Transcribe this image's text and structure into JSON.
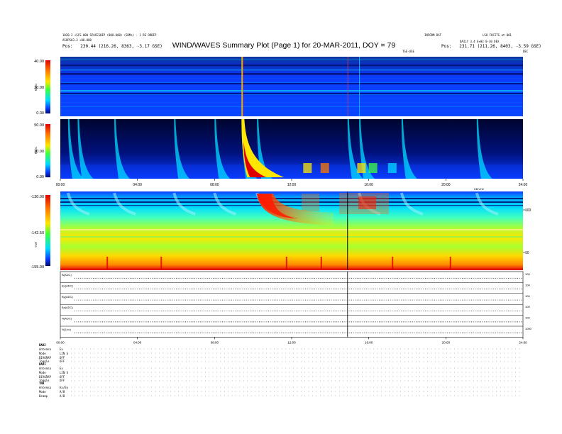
{
  "header": {
    "title": "WIND/WAVES Summary Plot (Page 1) for 20-MAR-2011, DOY = 79",
    "left_line1": "1020.3 ×SCS.000 SPACESHIP (008.000) (SDMs) - 1 RE ORBIP",
    "left_line2": "ASUPS03.3 ×00.000",
    "left_pos": "Pos:   230.44 (216.26, 8363, -3.17 GSE)",
    "right_top1": "INFORM DAT",
    "right_top2": "LS8 FOCITS at 001",
    "right_line2": "DAILY 3.4 E+03 0-30 DEX",
    "right_pos": "Pos:   231.71 (211.26, 8403, -3.59 GSE)",
    "unit_left": "TSE-USE",
    "unit_right": "DEC"
  },
  "colors": {
    "dark": "#000a6e",
    "blue": "#0a3cff",
    "cyan": "#00dcff",
    "green": "#40ff40",
    "yellow": "#ffe600",
    "orange": "#ff7a00",
    "red": "#e00000"
  },
  "chart_data": [
    {
      "type": "heatmap",
      "panel": "RAD2",
      "ylabel": "RAD2",
      "y_ticks": [
        "40.00",
        "20.00",
        "0.00"
      ],
      "ylim": [
        0,
        40
      ],
      "x_ticks": []
    },
    {
      "type": "heatmap",
      "panel": "RAD1",
      "ylabel": "RAD1",
      "y_ticks": [
        "50.00",
        "30.00",
        "0.00"
      ],
      "ylim": [
        0,
        50
      ],
      "x_ticks": [
        "00:00",
        "04:00",
        "08:00",
        "12:00",
        "16:00",
        "20:00",
        "24:00"
      ],
      "x_hours": [
        0,
        4,
        8,
        12,
        16,
        20,
        24
      ],
      "type_iii_bursts_hours": [
        0.4,
        0.9,
        2.8,
        5.9,
        8.0,
        9.4,
        10.2,
        14.9,
        15.5,
        17.7,
        21.6
      ]
    },
    {
      "type": "heatmap",
      "panel": "TNR",
      "ylabel": "TNR",
      "y_ticks": [
        "-130.00",
        "-142.50",
        "-155.00"
      ],
      "ylim": [
        -155,
        -130
      ],
      "right_ticks": [
        "100",
        "10"
      ],
      "corner_label": "DB/VHZ",
      "marker_hour": 14.9
    },
    {
      "type": "line",
      "panel": "magnetometer",
      "rows": [
        {
          "label": "B(ADC)",
          "right": "100"
        },
        {
          "label": "Bx(ADC)",
          "right": "100"
        },
        {
          "label": "By(ADC)",
          "right": "100"
        },
        {
          "label": "Bz(ADC)",
          "right": "100"
        },
        {
          "label": "N(ADC)",
          "right": "100"
        },
        {
          "label": "N(1/cc)",
          "right": "1000"
        }
      ],
      "x_ticks": [
        "00:00",
        "04:00",
        "08:00",
        "12:00",
        "16:00",
        "20:00",
        "24:00"
      ],
      "x_hours": [
        0,
        4,
        8,
        12,
        16,
        20,
        24
      ]
    }
  ],
  "footer": {
    "rad2_title": "RAD2",
    "rad2_rows": [
      {
        "label": "Antenna",
        "value": "Ex"
      },
      {
        "label": "Mode",
        "value": "LIN S"
      },
      {
        "label": "DIAGRAP",
        "value": "OFF"
      },
      {
        "label": "Toggle",
        "value": "OFF"
      }
    ],
    "rad1_title": "RAD1",
    "rad1_rows": [
      {
        "label": "Antenna",
        "value": "Ex"
      },
      {
        "label": "Mode",
        "value": "LIN S"
      },
      {
        "label": "DIAGRAP",
        "value": "OFF"
      },
      {
        "label": "Toggle",
        "value": "OFF"
      }
    ],
    "tnr_title": "TNR",
    "tnr_rows": [
      {
        "label": "Antenna",
        "value": "Ex/Ey"
      },
      {
        "label": "Mode",
        "value": "A/B"
      },
      {
        "label": "Bcamp",
        "value": "A/B"
      }
    ]
  }
}
